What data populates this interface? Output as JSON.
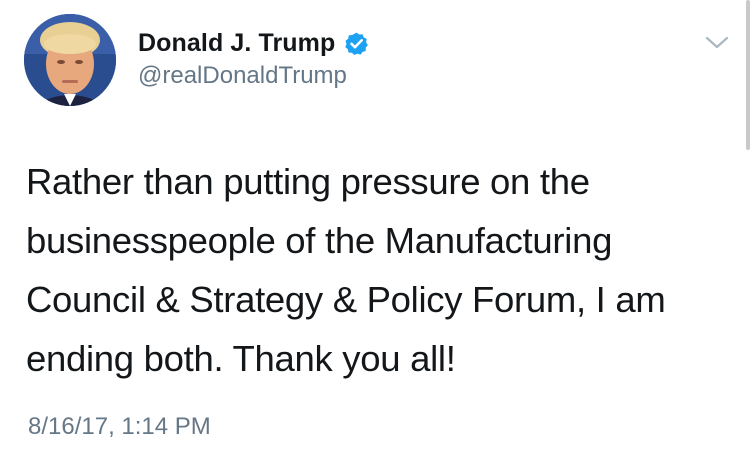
{
  "author": {
    "display_name": "Donald J. Trump",
    "handle": "@realDonaldTrump",
    "verified": true,
    "avatar_icon": "profile-photo"
  },
  "tweet": {
    "text": "Rather than putting pressure on the businesspeople of the Manufacturing Council & Strategy & Policy Forum, I am ending both. Thank you all!",
    "timestamp": "8/16/17, 1:14 PM"
  },
  "icons": {
    "verified": "verified-badge-icon",
    "menu": "chevron-down-icon"
  },
  "colors": {
    "verified_blue": "#1da1f2",
    "secondary_text": "#657786",
    "primary_text": "#14171a"
  }
}
